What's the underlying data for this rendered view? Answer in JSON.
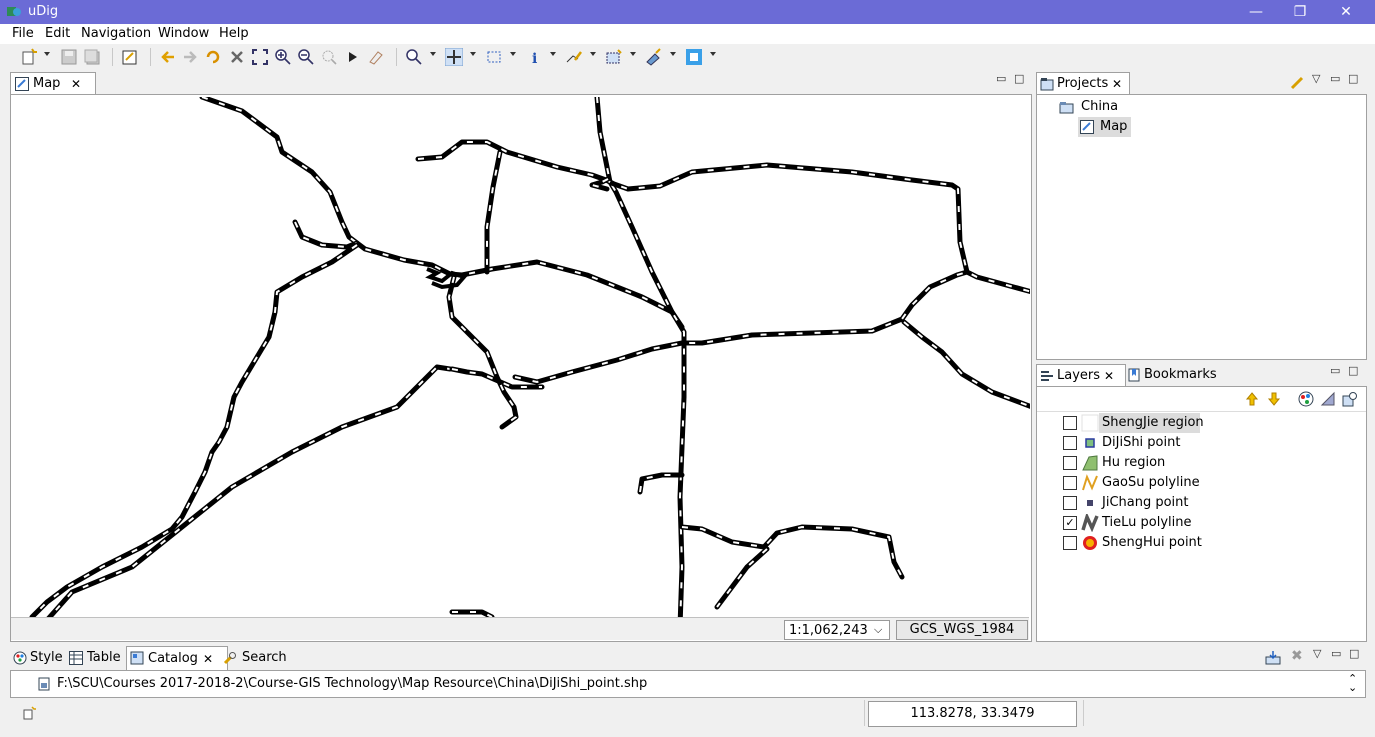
{
  "app": {
    "title": "uDig",
    "controls": [
      "—",
      "❐",
      "✕"
    ]
  },
  "menu": [
    "File",
    "Edit",
    "Navigation",
    "Window",
    "Help"
  ],
  "map_editor": {
    "tab_label": "Map",
    "scale": "1:1,062,243",
    "crs": "GCS_WGS_1984"
  },
  "projects": {
    "tab_label": "Projects",
    "project": "China",
    "map": "Map"
  },
  "layers": {
    "tab_label": "Layers",
    "bookmarks_label": "Bookmarks",
    "items": [
      {
        "label": "ShengJie region",
        "checked": false,
        "icon": "region-white-icon",
        "color": "#ffffff",
        "selected": true
      },
      {
        "label": "DiJiShi point",
        "checked": false,
        "icon": "point-square-green-icon",
        "color": "#7fbf7f"
      },
      {
        "label": "Hu region",
        "checked": false,
        "icon": "region-green-icon",
        "color": "#8fbf6f"
      },
      {
        "label": "GaoSu polyline",
        "checked": false,
        "icon": "polyline-yellow-icon",
        "color": "#e0a020"
      },
      {
        "label": "JiChang point",
        "checked": false,
        "icon": "point-square-navy-icon",
        "color": "#44446a"
      },
      {
        "label": "TieLu polyline",
        "checked": true,
        "icon": "polyline-gray-icon",
        "color": "#555555"
      },
      {
        "label": "ShengHui point",
        "checked": false,
        "icon": "point-circle-red-icon",
        "color": "#e02020"
      }
    ]
  },
  "bottom_tabs": [
    {
      "label": "Style",
      "icon": "style-icon"
    },
    {
      "label": "Table",
      "icon": "table-icon"
    },
    {
      "label": "Catalog",
      "icon": "catalog-icon",
      "active": true
    },
    {
      "label": "Search",
      "icon": "search-icon"
    }
  ],
  "catalog": {
    "path": "F:\\SCU\\Courses 2017-2018-2\\Course-GIS Technology\\Map Resource\\China\\DiJiShi_point.shp"
  },
  "status": {
    "coordinates": "113.8278, 33.3479"
  },
  "colors": {
    "titlebar": "#6b6bd6",
    "rail": "#000000",
    "selection": "#dcdcdc"
  }
}
